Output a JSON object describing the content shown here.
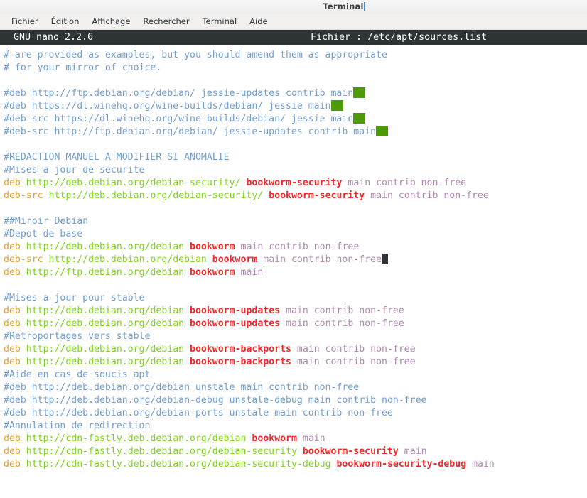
{
  "window": {
    "title": "Terminal",
    "has_title_caret": true
  },
  "menubar": {
    "items": [
      {
        "label": "Fichier",
        "name": "menu-fichier"
      },
      {
        "label": "Édition",
        "name": "menu-edition"
      },
      {
        "label": "Affichage",
        "name": "menu-affichage"
      },
      {
        "label": "Rechercher",
        "name": "menu-rechercher"
      },
      {
        "label": "Terminal",
        "name": "menu-terminal"
      },
      {
        "label": "Aide",
        "name": "menu-aide"
      }
    ]
  },
  "nano": {
    "version_label": "GNU nano 2.2.6",
    "file_label": "Fichier : /etc/apt/sources.list"
  },
  "colors": {
    "comment": "#729fcf",
    "deb_keyword": "#e2a33c",
    "url": "#7ed321",
    "suite": "#ef2929",
    "components": "#b18ab1",
    "whitespace_block": "#4e9a06",
    "cursor": "#2e3436",
    "statusbar_bg": "#2e3436",
    "background": "#ffffff"
  },
  "editor": {
    "lines": [
      {
        "type": "comment",
        "text": "# are provided as examples, but you should amend them as appropriate"
      },
      {
        "type": "comment",
        "text": "# for your mirror of choice."
      },
      {
        "type": "blank",
        "text": ""
      },
      {
        "type": "comment-ws",
        "text": "#deb http://ftp.debian.org/debian/ jessie-updates contrib main"
      },
      {
        "type": "comment-ws",
        "text": "#deb https://dl.winehq.org/wine-builds/debian/ jessie main"
      },
      {
        "type": "comment-ws",
        "text": "#deb-src https://dl.winehq.org/wine-builds/debian/ jessie main"
      },
      {
        "type": "comment-ws",
        "text": "#deb-src http://ftp.debian.org/debian/ jessie-updates contrib main"
      },
      {
        "type": "blank",
        "text": ""
      },
      {
        "type": "comment",
        "text": "#REDACTION MANUEL A MODIFIER SI ANOMALIE"
      },
      {
        "type": "comment",
        "text": "#Mises a jour de securite"
      },
      {
        "type": "repo",
        "keyword": "deb",
        "url": "http://deb.debian.org/debian-security/",
        "suite": "bookworm-security",
        "components": "main contrib non-free"
      },
      {
        "type": "repo",
        "keyword": "deb-src",
        "url": "http://deb.debian.org/debian-security/",
        "suite": "bookworm-security",
        "components": "main contrib non-free"
      },
      {
        "type": "blank",
        "text": ""
      },
      {
        "type": "comment",
        "text": "##Miroir Debian"
      },
      {
        "type": "comment",
        "text": "#Depot de base"
      },
      {
        "type": "repo",
        "keyword": "deb",
        "url": "http://deb.debian.org/debian",
        "suite": "bookworm",
        "components": "main contrib non-free"
      },
      {
        "type": "repo-cursor",
        "keyword": "deb-src",
        "url": "http://deb.debian.org/debian",
        "suite": "bookworm",
        "components": "main contrib non-free"
      },
      {
        "type": "repo",
        "keyword": "deb",
        "url": "http://ftp.debian.org/debian",
        "suite": "bookworm",
        "components": "main"
      },
      {
        "type": "blank",
        "text": ""
      },
      {
        "type": "comment",
        "text": "#Mises a jour pour stable"
      },
      {
        "type": "repo",
        "keyword": "deb",
        "url": "http://deb.debian.org/debian",
        "suite": "bookworm-updates",
        "components": "main contrib non-free"
      },
      {
        "type": "repo",
        "keyword": "deb",
        "url": "http://deb.debian.org/debian",
        "suite": "bookworm-updates",
        "components": "main contrib non-free"
      },
      {
        "type": "comment",
        "text": "#Retroportages vers stable"
      },
      {
        "type": "repo",
        "keyword": "deb",
        "url": "http://deb.debian.org/debian",
        "suite": "bookworm-backports",
        "components": "main contrib non-free"
      },
      {
        "type": "repo",
        "keyword": "deb",
        "url": "http://deb.debian.org/debian",
        "suite": "bookworm-backports",
        "components": "main contrib non-free"
      },
      {
        "type": "comment",
        "text": "#Aide en cas de soucis apt"
      },
      {
        "type": "comment",
        "text": "#deb http://deb.debian.org/debian unstale main contrib non-free"
      },
      {
        "type": "comment",
        "text": "#deb http://deb.debian.org/debian-debug unstale-debug main contrib non-free"
      },
      {
        "type": "comment",
        "text": "#deb http://deb.debian.org/debian-ports unstale main contrib non-free"
      },
      {
        "type": "comment",
        "text": "#Annulation de redirection"
      },
      {
        "type": "repo",
        "keyword": "deb",
        "url": "http://cdn-fastly.deb.debian.org/debian",
        "suite": "bookworm",
        "components": "main"
      },
      {
        "type": "repo",
        "keyword": "deb",
        "url": "http://cdn-fastly.deb.debian.org/debian-security",
        "suite": "bookworm-security",
        "components": "main"
      },
      {
        "type": "repo",
        "keyword": "deb",
        "url": "http://cdn-fastly.deb.debian.org/debian-security-debug",
        "suite": "bookworm-security-debug",
        "components": "main"
      }
    ]
  }
}
